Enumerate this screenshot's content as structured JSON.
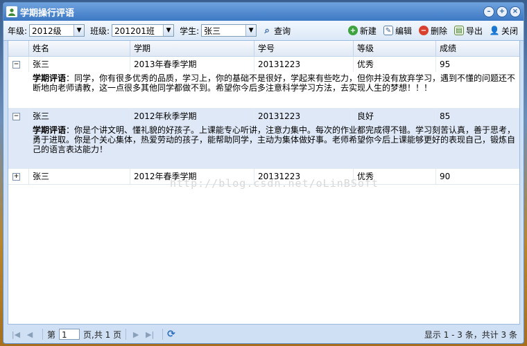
{
  "window": {
    "title": "学期操行评语"
  },
  "toolbar": {
    "grade_label": "年级:",
    "grade_value": "2012级",
    "class_label": "班级:",
    "class_value": "201201班",
    "student_label": "学生:",
    "student_value": "张三",
    "query_label": "查询",
    "add_label": "新建",
    "edit_label": "编辑",
    "delete_label": "删除",
    "export_label": "导出",
    "close_label": "关闭"
  },
  "grid": {
    "columns": [
      "姓名",
      "学期",
      "学号",
      "等级",
      "成绩"
    ],
    "comment_label": "学期评语",
    "rows": [
      {
        "name": "张三",
        "term": "2013年春季学期",
        "student_id": "20131223",
        "level": "优秀",
        "score": "95",
        "expanded": true,
        "comment": "：同学，你有很多优秀的品质，学习上，你的基础不是很好，学起来有些吃力，但你并没有放弃学习，遇到不懂的问题还不断地向老师请教，这一点很多其他同学都做不到。希望你今后多注意科学学习方法，去实现人生的梦想！！！"
      },
      {
        "name": "张三",
        "term": "2012年秋季学期",
        "student_id": "20131223",
        "level": "良好",
        "score": "85",
        "expanded": true,
        "comment": "：你是个讲文明、懂礼貌的好孩子。上课能专心听讲，注意力集中。每次的作业都完成得不错。学习刻苦认真，善于思考，勇于进取。你是个关心集体，热爱劳动的孩子，能帮助同学，主动为集体做好事。老师希望你今后上课能够更好的表现自己，锻炼自己的语言表达能力！"
      },
      {
        "name": "张三",
        "term": "2012年春季学期",
        "student_id": "20131223",
        "level": "优秀",
        "score": "90",
        "expanded": false,
        "comment": ""
      }
    ]
  },
  "pager": {
    "page_prefix": "第",
    "page_value": "1",
    "page_suffix": "页,共 1 页",
    "info": "显示 1 - 3 条，共计 3 条"
  },
  "watermark": "http://blog.csdn.net/oLinBSoft"
}
